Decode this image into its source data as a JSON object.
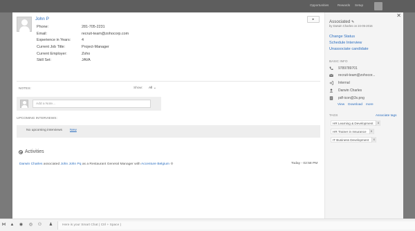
{
  "background_nav": [
    "Opportunities",
    "Rewards",
    "Setup"
  ],
  "candidate": {
    "name": "John P",
    "fields": [
      {
        "label": "Phone:",
        "value": "281-705-2231"
      },
      {
        "label": "Email:",
        "value": "recruit-team@zohocorp.com"
      },
      {
        "label": "Experience in Years:",
        "value": "4"
      },
      {
        "label": "Current Job Title:",
        "value": "Project-Manager"
      },
      {
        "label": "Current Employer:",
        "value": "Zoho"
      },
      {
        "label": "Skill Set:",
        "value": "JAVA"
      }
    ]
  },
  "notes": {
    "label": "NOTES:",
    "show_label": "Show:",
    "show_value": "All",
    "placeholder": "Add a Note..."
  },
  "upcoming": {
    "label": "UPCOMING INTERVIEWS:",
    "empty_text": "No upcoming interviews",
    "new_link": "New"
  },
  "activities": {
    "title": "Activities",
    "item": {
      "actor": "Darwin Charles",
      "verb": "associated",
      "candidate": "John John Pq",
      "mid": "as a Restaurant General Manager with",
      "company": "Accenture Belgium",
      "time": "Today - 02:58 PM"
    }
  },
  "right_panel": {
    "status": "Associated",
    "by": "by Darwin Charles on 24-05-2016",
    "actions": [
      "Change Status",
      "Schedule Interview",
      "Unassociate candidate"
    ],
    "basic_info_label": "BASIC INFO",
    "info": {
      "phone": "9789789701",
      "email": "recruit-team@zohocor...",
      "source": "Internal",
      "owner": "Darwin Charles",
      "file": "pdf-icon@3x.png"
    },
    "file_links": [
      "View",
      "Download",
      "more"
    ],
    "tags_label": "TAGS",
    "associate_tags": "Associate tags",
    "tags": [
      "HR Learning & Development",
      "HR Trainer in Insurance",
      "IT Business Development"
    ]
  },
  "bottom_bar": {
    "chat_placeholder": "Here is your Smart Chat ( Ctrl + Space )"
  },
  "icons": {
    "close": "close-icon",
    "next": "chevron-right-icon",
    "edit": "pencil-icon"
  }
}
